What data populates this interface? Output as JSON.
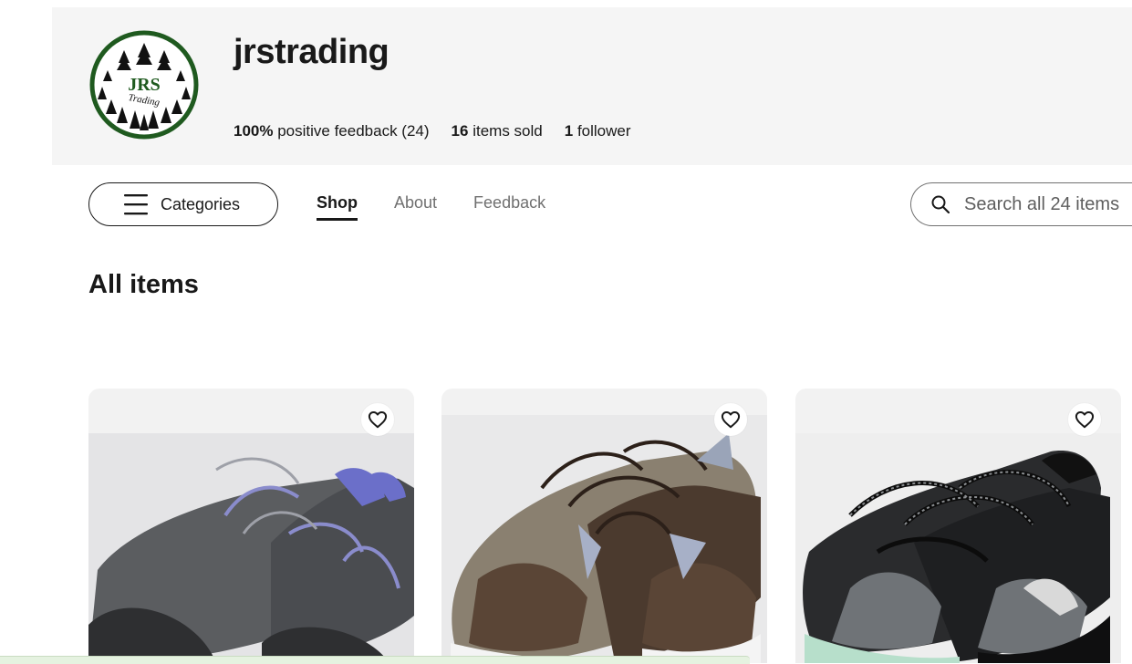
{
  "store": {
    "logo_text": "JRS",
    "logo_subtext": "Trading",
    "name": "jrstrading",
    "feedback_pct": "100%",
    "feedback_label": "positive feedback (24)",
    "items_sold_count": "16",
    "items_sold_label": "items sold",
    "followers_count": "1",
    "followers_label": "follower"
  },
  "nav": {
    "categories_label": "Categories",
    "tabs": [
      {
        "label": "Shop",
        "active": true
      },
      {
        "label": "About",
        "active": false
      },
      {
        "label": "Feedback",
        "active": false
      }
    ],
    "search_placeholder": "Search all 24 items"
  },
  "main": {
    "title": "All items"
  },
  "items": [
    {
      "image": "gray and purple sneakers",
      "favorite_icon": "heart-icon"
    },
    {
      "image": "brown and silver Nike sneakers",
      "favorite_icon": "heart-icon"
    },
    {
      "image": "black Saucony trail sneakers",
      "favorite_icon": "heart-icon"
    }
  ],
  "colors": {
    "header_bg": "#f5f5f5",
    "logo_green": "#1f5a1f",
    "text": "#191919",
    "muted": "#707070"
  }
}
